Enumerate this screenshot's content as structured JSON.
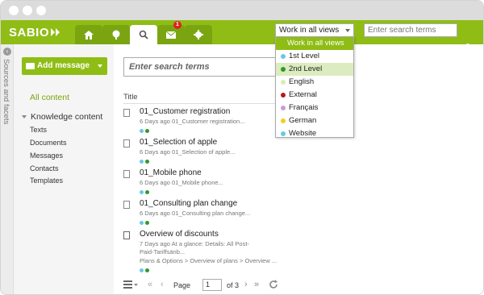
{
  "app": {
    "logo": "SABIO"
  },
  "colors": {
    "brand_green": "#8fbd15",
    "tab_dark": "#7aa511",
    "notification": "#e02020"
  },
  "tabs": [
    {
      "name": "home-icon"
    },
    {
      "name": "tree-icon"
    },
    {
      "name": "search-icon",
      "active": true
    },
    {
      "name": "envelope-icon",
      "badge": "1"
    },
    {
      "name": "gear-icon"
    }
  ],
  "header": {
    "views_selected": "Work in all views",
    "search_placeholder": "Enter search terms"
  },
  "views_dropdown": {
    "items": [
      {
        "label": "Work in all views",
        "color": "",
        "selected": true
      },
      {
        "label": "1st Level",
        "color": "#6cc6e6"
      },
      {
        "label": "2nd Level",
        "color": "#2e9a2e",
        "highlighted": true
      },
      {
        "label": "English",
        "color": "#d9eeb0"
      },
      {
        "label": "External",
        "color": "#b31b1b"
      },
      {
        "label": "Français",
        "color": "#c79be0"
      },
      {
        "label": "German",
        "color": "#f0d020"
      },
      {
        "label": "Website",
        "color": "#6cc6e6"
      }
    ]
  },
  "leftbar": {
    "label": "Sources and facets"
  },
  "sidebar": {
    "add_button": "Add message",
    "all_content": "All content",
    "knowledge_content": "Knowledge content",
    "items": [
      "Texts",
      "Documents",
      "Messages",
      "Contacts",
      "Templates"
    ]
  },
  "content": {
    "search_placeholder": "Enter search terms",
    "column_title": "Title",
    "rows": [
      {
        "title": "01_Customer registration",
        "meta": "6 Days ago 01_Customer registration...",
        "dots": [
          "#6cc6e6",
          "#2e9a2e"
        ]
      },
      {
        "title": "01_Selection of apple",
        "meta": "6 Days ago 01_Selection of apple...",
        "dots": [
          "#6cc6e6",
          "#2e9a2e"
        ]
      },
      {
        "title": "01_Mobile phone",
        "meta": "6 Days ago 01_Mobile phone...",
        "dots": [
          "#6cc6e6",
          "#2e9a2e"
        ]
      },
      {
        "title": "01_Consulting plan change",
        "meta": "6 Days ago 01_Consulting plan change...",
        "dots": [
          "#6cc6e6",
          "#2e9a2e"
        ]
      },
      {
        "title": "Overview of discounts",
        "meta": "7 Days ago   At a glance:   Details:    All Post-",
        "meta2": "Paid-Tariffsänb...",
        "meta3": "Plans & Options > Overview of plans > Overview ...",
        "dots": [
          "#6cc6e6",
          "#2e9a2e"
        ]
      }
    ]
  },
  "pager": {
    "page_label": "Page",
    "page": "1",
    "of": "of 3"
  }
}
